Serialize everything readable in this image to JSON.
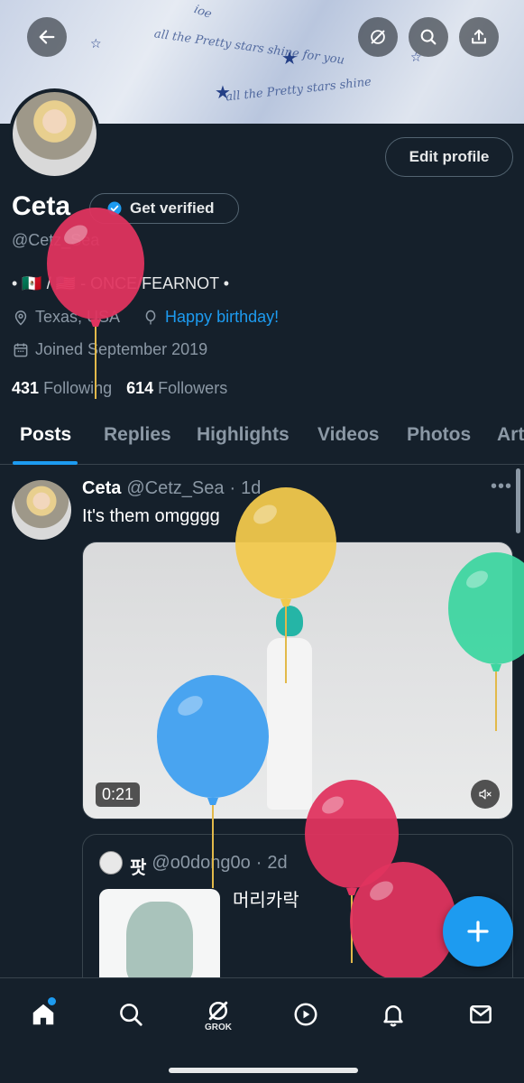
{
  "banner": {
    "doodle_texts": [
      "all the Pretty stars shine for you",
      "all the Pretty stars shine",
      "ioe"
    ]
  },
  "header_actions": {
    "back_icon": "back-arrow-icon",
    "grok_icon": "grok-icon",
    "search_icon": "search-icon",
    "share_icon": "share-icon"
  },
  "profile": {
    "name": "Ceta",
    "verify_label": "Get verified",
    "handle": "@Cetz_Sea",
    "bio": "• 🇲🇽 / 🇺🇸 - ONCE/FEARNOT •",
    "location": "Texas, USA",
    "birthday": "Happy birthday!",
    "joined": "Joined September 2019",
    "following_count": "431",
    "following_label": "Following",
    "followers_count": "614",
    "followers_label": "Followers",
    "edit_label": "Edit profile"
  },
  "tabs": [
    "Posts",
    "Replies",
    "Highlights",
    "Videos",
    "Photos",
    "Art"
  ],
  "post": {
    "author": "Ceta",
    "handle": "@Cetz_Sea",
    "sep": "·",
    "time": "1d",
    "text": "It's them omgggg",
    "more": "•••",
    "video_duration": "0:21",
    "quote": {
      "author": "팟",
      "handle": "@o0dong0o",
      "sep": "·",
      "time": "2d",
      "text": "머리카락"
    }
  },
  "fab_label": "+",
  "bottom_nav": {
    "grok_label": "GROK",
    "items": [
      "home-icon",
      "search-icon",
      "grok-icon",
      "video-icon",
      "notifications-icon",
      "messages-icon"
    ]
  },
  "colors": {
    "accent": "#1d9bf0",
    "background": "#15202b",
    "balloon_red": "#e0335f",
    "balloon_yellow": "#f2c94c",
    "balloon_green": "#3ed6a0",
    "balloon_blue": "#3f9ff0"
  }
}
